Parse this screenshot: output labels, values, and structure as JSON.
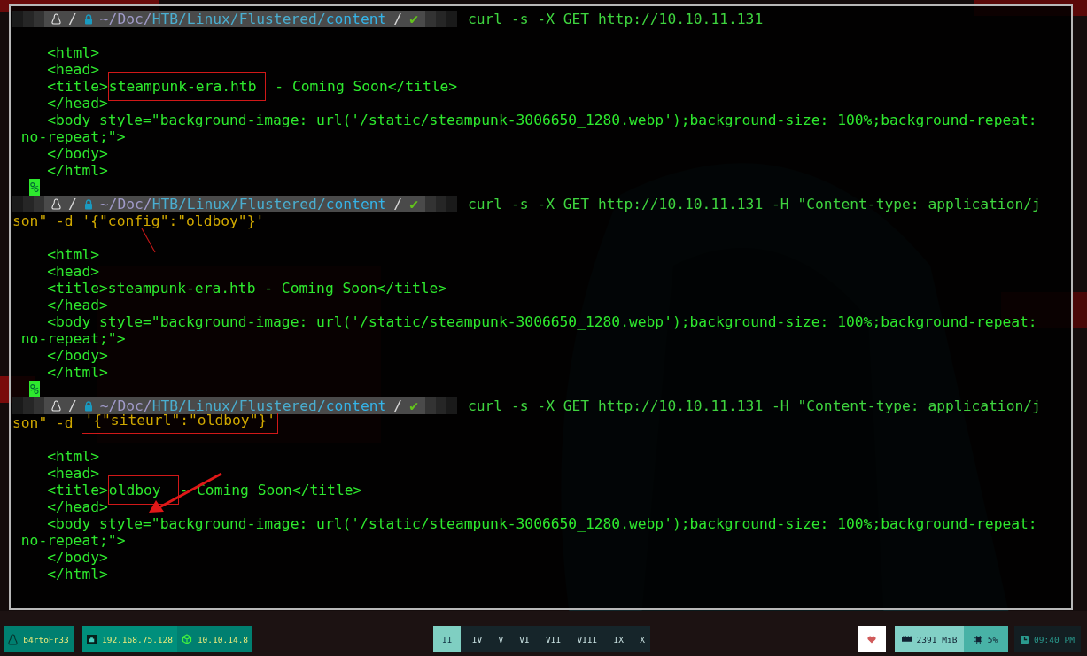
{
  "terminal": {
    "blocks": [
      {
        "prompt": {
          "separator": "/",
          "path": "~/Doc/HTB/Linux/Flustered/",
          "dir": "content",
          "status": "✔"
        },
        "command_lines": [
          [
            {
              "text": "curl -s -X GET http://10.10.11.131",
              "kind": "plain",
              "boxed": false
            }
          ]
        ],
        "output_lines": [
          [
            {
              "text": "    <html>",
              "boxed": false
            }
          ],
          [
            {
              "text": "    <head>",
              "boxed": false
            }
          ],
          [
            {
              "text": "    <title>",
              "boxed": false
            },
            {
              "text": "steampunk-era.htb",
              "boxed": true
            },
            {
              "text": " - Coming Soon</title>",
              "boxed": false
            }
          ],
          [
            {
              "text": "    </head>",
              "boxed": false
            }
          ],
          [
            {
              "text": "    <body style=\"background-image: url('/static/steampunk-3006650_1280.webp');background-size: 100%;background-repeat:",
              "boxed": false
            }
          ],
          [
            {
              "text": " no-repeat;\">",
              "boxed": false
            }
          ],
          [
            {
              "text": "    </body>",
              "boxed": false
            }
          ],
          [
            {
              "text": "    </html>",
              "boxed": false
            }
          ]
        ],
        "end_mark": "%"
      },
      {
        "prompt": {
          "separator": "/",
          "path": "~/Doc/HTB/Linux/Flustered/",
          "dir": "content",
          "status": "✔"
        },
        "command_lines": [
          [
            {
              "text": "curl -s -X GET http://10.10.11.131 -H \"Content-type: application/j",
              "kind": "plain",
              "boxed": false
            }
          ],
          [
            {
              "text": "son\" -d '{\"config\":\"oldboy\"}'",
              "kind": "string",
              "boxed": false
            }
          ]
        ],
        "output_lines": [
          [
            {
              "text": "    <html>",
              "boxed": false
            }
          ],
          [
            {
              "text": "    <head>",
              "boxed": false
            }
          ],
          [
            {
              "text": "    <title>steampunk-era.htb - Coming Soon</title>",
              "boxed": false
            }
          ],
          [
            {
              "text": "    </head>",
              "boxed": false
            }
          ],
          [
            {
              "text": "    <body style=\"background-image: url('/static/steampunk-3006650_1280.webp');background-size: 100%;background-repeat:",
              "boxed": false
            }
          ],
          [
            {
              "text": " no-repeat;\">",
              "boxed": false
            }
          ],
          [
            {
              "text": "    </body>",
              "boxed": false
            }
          ],
          [
            {
              "text": "    </html>",
              "boxed": false
            }
          ]
        ],
        "end_mark": "%"
      },
      {
        "prompt": {
          "separator": "/",
          "path": "~/Doc/HTB/Linux/Flustered/",
          "dir": "content",
          "status": "✔"
        },
        "command_lines": [
          [
            {
              "text": "curl -s -X GET http://10.10.11.131 -H \"Content-type: application/j",
              "kind": "plain",
              "boxed": false
            }
          ],
          [
            {
              "text": "son\" -d ",
              "kind": "string",
              "boxed": false
            },
            {
              "text": "'{\"siteurl\":\"oldboy\"}'",
              "kind": "string",
              "boxed": true
            }
          ]
        ],
        "output_lines": [
          [
            {
              "text": "    <html>",
              "boxed": false
            }
          ],
          [
            {
              "text": "    <head>",
              "boxed": false
            }
          ],
          [
            {
              "text": "    <title>",
              "boxed": false
            },
            {
              "text": "oldboy ",
              "boxed": true
            },
            {
              "text": "- Coming Soon</title>",
              "boxed": false
            }
          ],
          [
            {
              "text": "    </head>",
              "boxed": false
            }
          ],
          [
            {
              "text": "    <body style=\"background-image: url('/static/steampunk-3006650_1280.webp');background-size: 100%;background-repeat:",
              "boxed": false
            }
          ],
          [
            {
              "text": " no-repeat;\">",
              "boxed": false
            }
          ],
          [
            {
              "text": "    </body>",
              "boxed": false
            }
          ],
          [
            {
              "text": "    </html>",
              "boxed": false
            }
          ]
        ]
      }
    ]
  },
  "taskbar": {
    "user": "b4rtoFr33",
    "local_ip": "192.168.75.128",
    "vpn_ip": "10.10.14.8",
    "workspaces": [
      {
        "label": "II",
        "selected": true
      },
      {
        "label": "IV",
        "selected": false
      },
      {
        "label": "V",
        "selected": false
      },
      {
        "label": "VI",
        "selected": false
      },
      {
        "label": "VII",
        "selected": false
      },
      {
        "label": "VIII",
        "selected": false
      },
      {
        "label": "IX",
        "selected": false
      },
      {
        "label": "X",
        "selected": false
      }
    ],
    "memory": "2391 MiB",
    "cpu": "5%",
    "clock": "09:40 PM"
  }
}
